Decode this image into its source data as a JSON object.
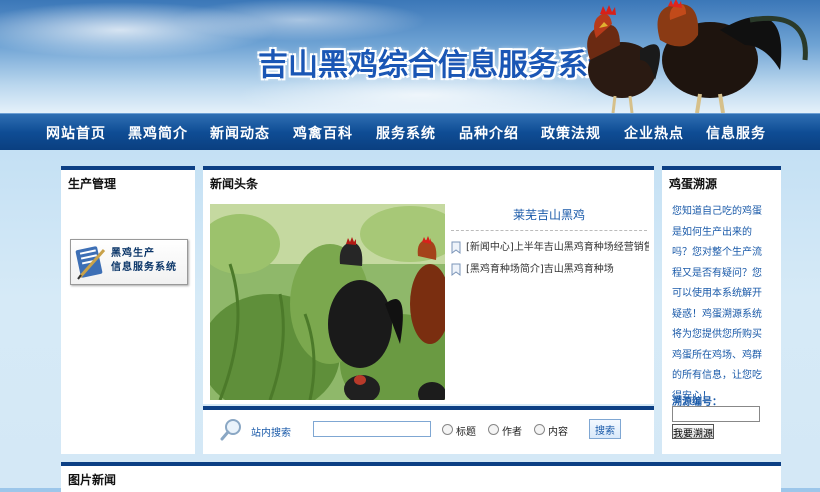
{
  "header": {
    "title": "吉山黑鸡综合信息服务系统"
  },
  "nav": {
    "items": [
      "网站首页",
      "黑鸡简介",
      "新闻动态",
      "鸡禽百科",
      "服务系统",
      "品种介绍",
      "政策法规",
      "企业热点",
      "信息服务"
    ]
  },
  "left_panel": {
    "title": "生产管理",
    "logo_line1": "黑鸡生产",
    "logo_line2": "信息服务系统"
  },
  "news_panel": {
    "title": "新闻头条",
    "featured_title": "莱芜吉山黑鸡",
    "items": [
      "[新闻中心]上半年吉山黑鸡育种场经营销售情",
      "[黑鸡育种场简介]吉山黑鸡育种场"
    ]
  },
  "search": {
    "label": "站内搜索",
    "value": "",
    "options": [
      "标题",
      "作者",
      "内容"
    ],
    "button": "搜索"
  },
  "trace_panel": {
    "title": "鸡蛋溯源",
    "description": "您知道自己吃的鸡蛋是如何生产出来的吗？您对整个生产流程又是否有疑问？您可以使用本系统解开疑惑！鸡蛋溯源系统将为您提供您所购买鸡蛋所在鸡场、鸡群的所有信息，让您吃得安心！",
    "code_label": "溯源编号：",
    "code_value": "",
    "button": "我要溯源"
  },
  "bottom_panel": {
    "title": "图片新闻"
  },
  "colors": {
    "nav_bg": "#0f4d95",
    "panel_border": "#0c3f84",
    "link_blue": "#1a5aa9"
  }
}
